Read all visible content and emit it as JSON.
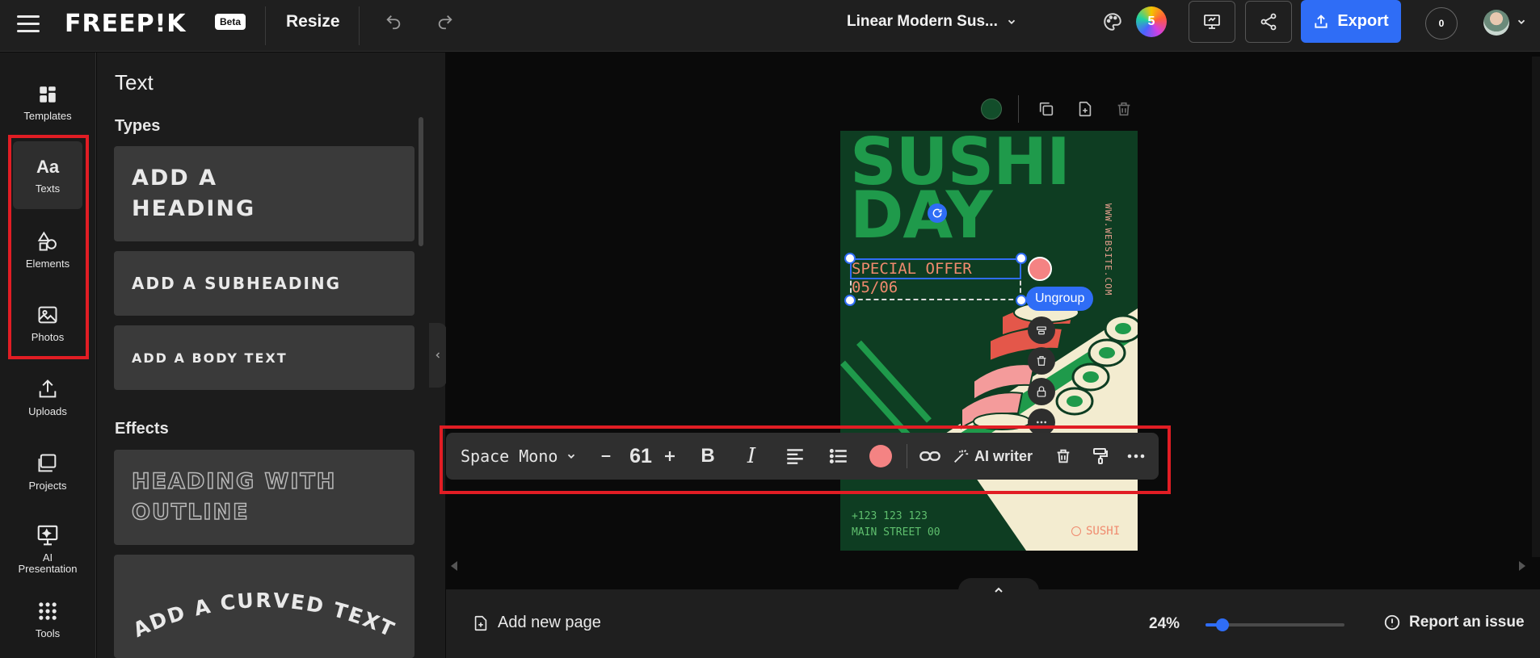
{
  "header": {
    "logo": "FREEP!K",
    "beta": "Beta",
    "resize": "Resize",
    "doc_title": "Linear Modern Sus...",
    "collab_count": "5",
    "export": "Export",
    "notifications": "0"
  },
  "rail": {
    "items": [
      {
        "label": "Templates",
        "icon": "grid-icon"
      },
      {
        "label": "Texts",
        "icon": "text-icon",
        "active": true
      },
      {
        "label": "Elements",
        "icon": "shapes-icon"
      },
      {
        "label": "Photos",
        "icon": "image-icon"
      },
      {
        "label": "Uploads",
        "icon": "upload-icon"
      },
      {
        "label": "Projects",
        "icon": "folder-icon"
      },
      {
        "label": "AI Presentation",
        "icon": "presentation-icon"
      },
      {
        "label": "Tools",
        "icon": "apps-icon"
      }
    ]
  },
  "panel": {
    "title": "Text",
    "types_title": "Types",
    "heading": "ADD A HEADING",
    "subheading": "ADD A SUBHEADING",
    "body": "ADD A BODY TEXT",
    "effects_title": "Effects",
    "outline": "HEADING WITH OUTLINE",
    "curved": "ADD A CURVED TEXT"
  },
  "poster": {
    "title_line1": "SUSHI",
    "title_line2": "DAY",
    "website": "WWW.WEBSITE.COM",
    "offer_line1": "SPECIAL OFFER",
    "offer_line2": "05/06",
    "phone": "+123 123 123",
    "address": "MAIN STREET 00",
    "brand": "SUSHI"
  },
  "context": {
    "ungroup": "Ungroup"
  },
  "toolbar": {
    "font": "Space Mono",
    "size": "61",
    "text_color": "#f48383",
    "ai_writer": "AI writer"
  },
  "bottom": {
    "add_page": "Add new page",
    "zoom": "24%",
    "zoom_value": 0.24,
    "report": "Report an issue"
  },
  "colors": {
    "accent": "#2f6df6",
    "highlight": "#e11d24",
    "poster_bg": "#0e3d22",
    "poster_green": "#1f9a4b",
    "salmon": "#f08a6e"
  }
}
